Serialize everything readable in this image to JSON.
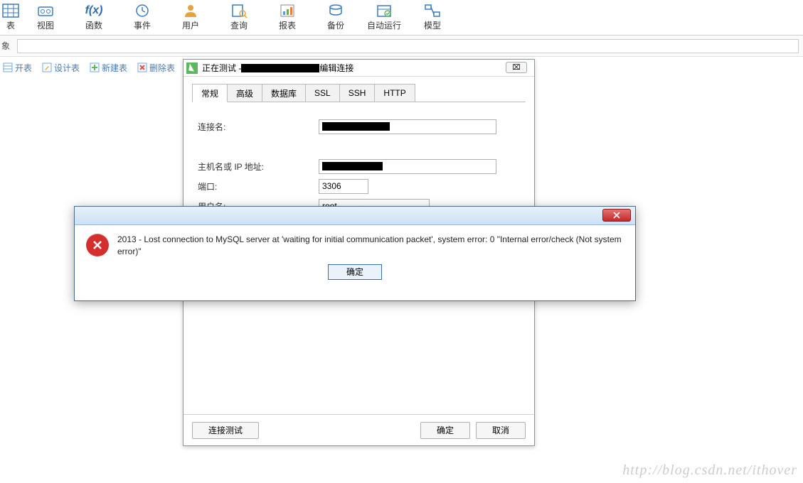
{
  "ribbon": {
    "items": [
      {
        "label": "表"
      },
      {
        "label": "视图"
      },
      {
        "label": "函数"
      },
      {
        "label": "事件"
      },
      {
        "label": "用户"
      },
      {
        "label": "查询"
      },
      {
        "label": "报表"
      },
      {
        "label": "备份"
      },
      {
        "label": "自动运行"
      },
      {
        "label": "模型"
      }
    ]
  },
  "sub_prefix": "象",
  "toolstrip": {
    "items": [
      {
        "label": "开表"
      },
      {
        "label": "设计表"
      },
      {
        "label": "新建表"
      },
      {
        "label": "删除表"
      }
    ]
  },
  "conn_dialog": {
    "title_prefix": "正在测试 - ",
    "title_suffix": "编辑连接",
    "close_glyph": "⌧",
    "tabs": [
      "常规",
      "高级",
      "数据库",
      "SSL",
      "SSH",
      "HTTP"
    ],
    "labels": {
      "conn_name": "连接名:",
      "host": "主机名或 IP 地址:",
      "port": "端口:",
      "user": "用户名:"
    },
    "values": {
      "port": "3306",
      "user": "root",
      "password_mask": "•••••••••••"
    },
    "buttons": {
      "test": "连接测试",
      "ok": "确定",
      "cancel": "取消"
    }
  },
  "error_modal": {
    "message": "2013 - Lost connection to MySQL server at 'waiting for initial communication packet', system error: 0 \"Internal error/check (Not system error)\"",
    "ok": "确定"
  },
  "watermark": "http://blog.csdn.net/ithover"
}
